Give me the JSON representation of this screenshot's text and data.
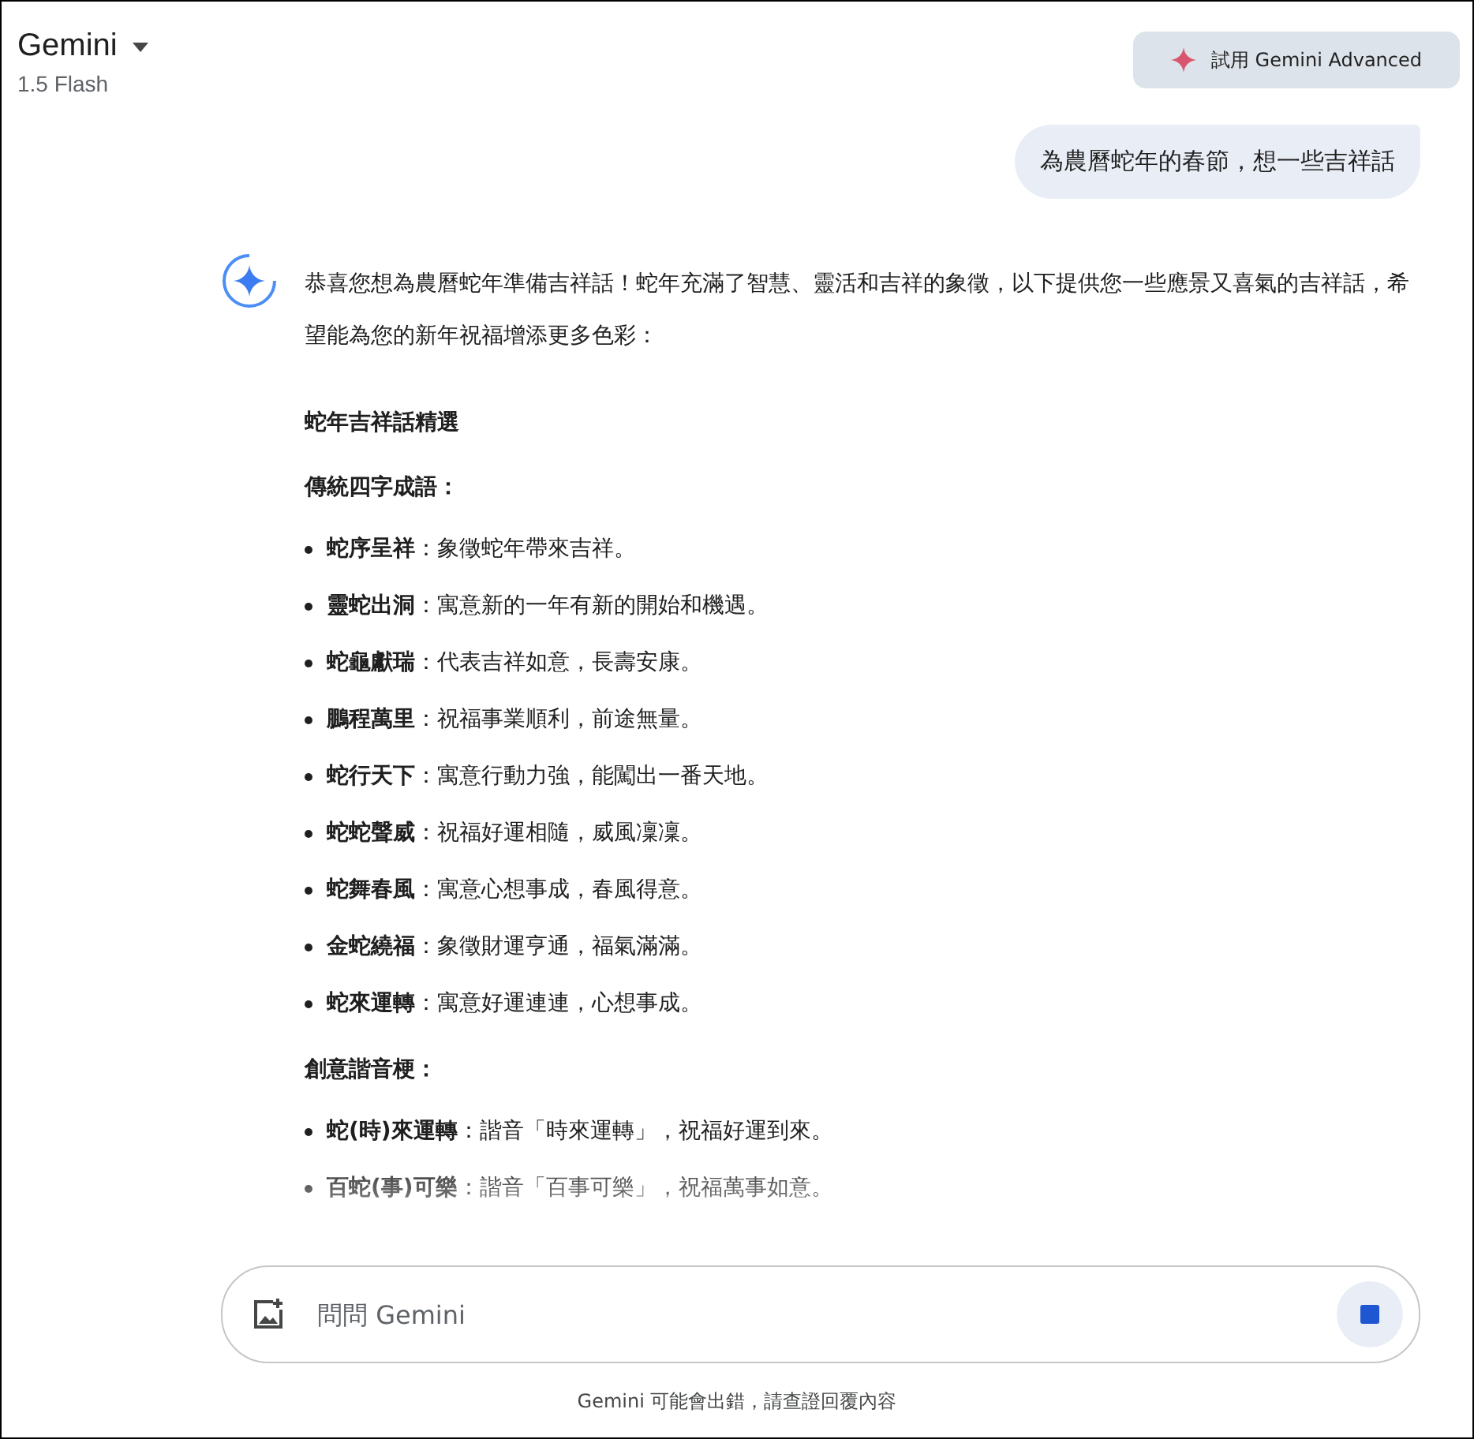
{
  "header": {
    "title": "Gemini",
    "model": "1.5 Flash",
    "upgrade_button": "試用 Gemini Advanced"
  },
  "user_message": "為農曆蛇年的春節，想一些吉祥話",
  "response": {
    "intro": "恭喜您想為農曆蛇年準備吉祥話！蛇年充滿了智慧、靈活和吉祥的象徵，以下提供您一些應景又喜氣的吉祥話，希望能為您的新年祝福增添更多色彩：",
    "heading": "蛇年吉祥話精選",
    "sections": [
      {
        "title": "傳統四字成語：",
        "items": [
          "**蛇序呈祥**：象徵蛇年帶來吉祥。",
          "**靈蛇出洞**：寓意新的一年有新的開始和機遇。",
          "**蛇龜獻瑞**：代表吉祥如意，長壽安康。",
          "**鵬程萬里**：祝福事業順利，前途無量。",
          "**蛇行天下**：寓意行動力強，能闖出一番天地。",
          "**蛇蛇聲威**：祝福好運相隨，威風凜凜。",
          "**蛇舞春風**：寓意心想事成，春風得意。",
          "**金蛇繞福**：象徵財運亨通，福氣滿滿。",
          "**蛇來運轉**：寓意好運連連，心想事成。"
        ]
      },
      {
        "title": "創意諧音梗：",
        "items": [
          "**蛇(時)來運轉**：諧音「時來運轉」，祝福好運到來。",
          "**百蛇(事)可樂**：諧音「百事可樂」，祝福萬事如意。"
        ]
      }
    ]
  },
  "composer": {
    "placeholder": "問問 Gemini"
  },
  "disclaimer": "Gemini 可能會出錯，請查證回覆內容"
}
